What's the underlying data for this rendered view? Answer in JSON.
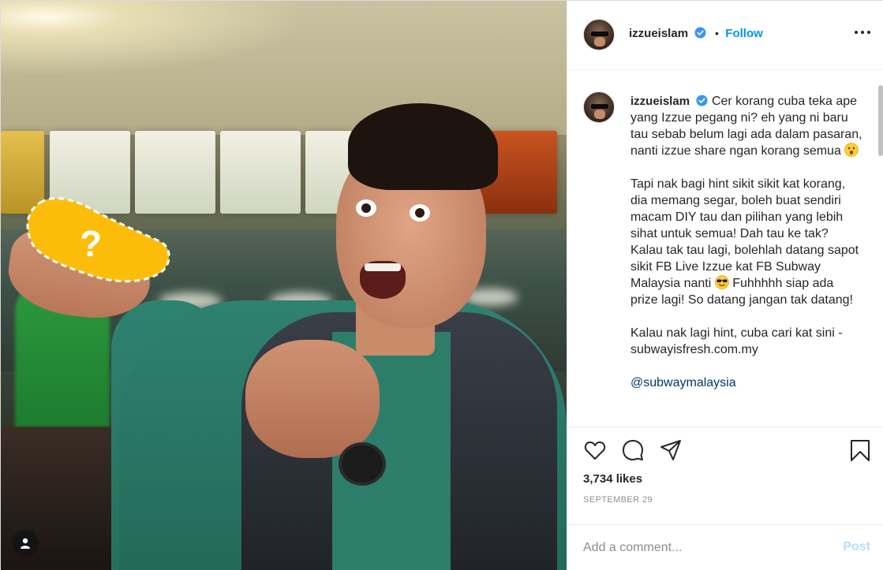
{
  "post": {
    "username": "izzueislam",
    "follow_label": "Follow",
    "follow_separator": "•",
    "caption_paragraphs": [
      "Cer korang cuba teka ape yang Izzue pegang ni? eh yang ni baru tau sebab belum lagi ada dalam pasaran, nanti izzue share ngan korang semua",
      "Tapi nak bagi hint sikit sikit kat korang, dia memang segar, boleh buat sendiri macam DIY tau dan pilihan yang lebih sihat untuk semua! Dah tau ke tak? Kalau tak tau lagi, bolehlah datang sapot sikit FB Live Izzue kat FB Subway Malaysia nanti",
      "Fuhhhhh siap ada prize lagi! So datang jangan tak datang!",
      "Kalau nak lagi hint, cuba cari kat sini - subwayisfresh.com.my"
    ],
    "mention": "@subwaymalaysia",
    "likes": "3,734 likes",
    "date": "SEPTEMBER 29",
    "comment_placeholder": "Add a comment...",
    "post_label": "Post",
    "photo_overlay_symbol": "?"
  },
  "icons": {
    "more": "more-options-icon",
    "like": "heart-icon",
    "comment": "comment-bubble-icon",
    "share": "paper-plane-icon",
    "save": "bookmark-icon",
    "verified": "verified-badge-icon",
    "user": "user-tag-icon"
  },
  "colors": {
    "accent": "#0095f6",
    "verified": "#3897f0",
    "post_disabled": "#b2dffc",
    "mention": "#00376b",
    "blob": "#fcbd0a"
  }
}
